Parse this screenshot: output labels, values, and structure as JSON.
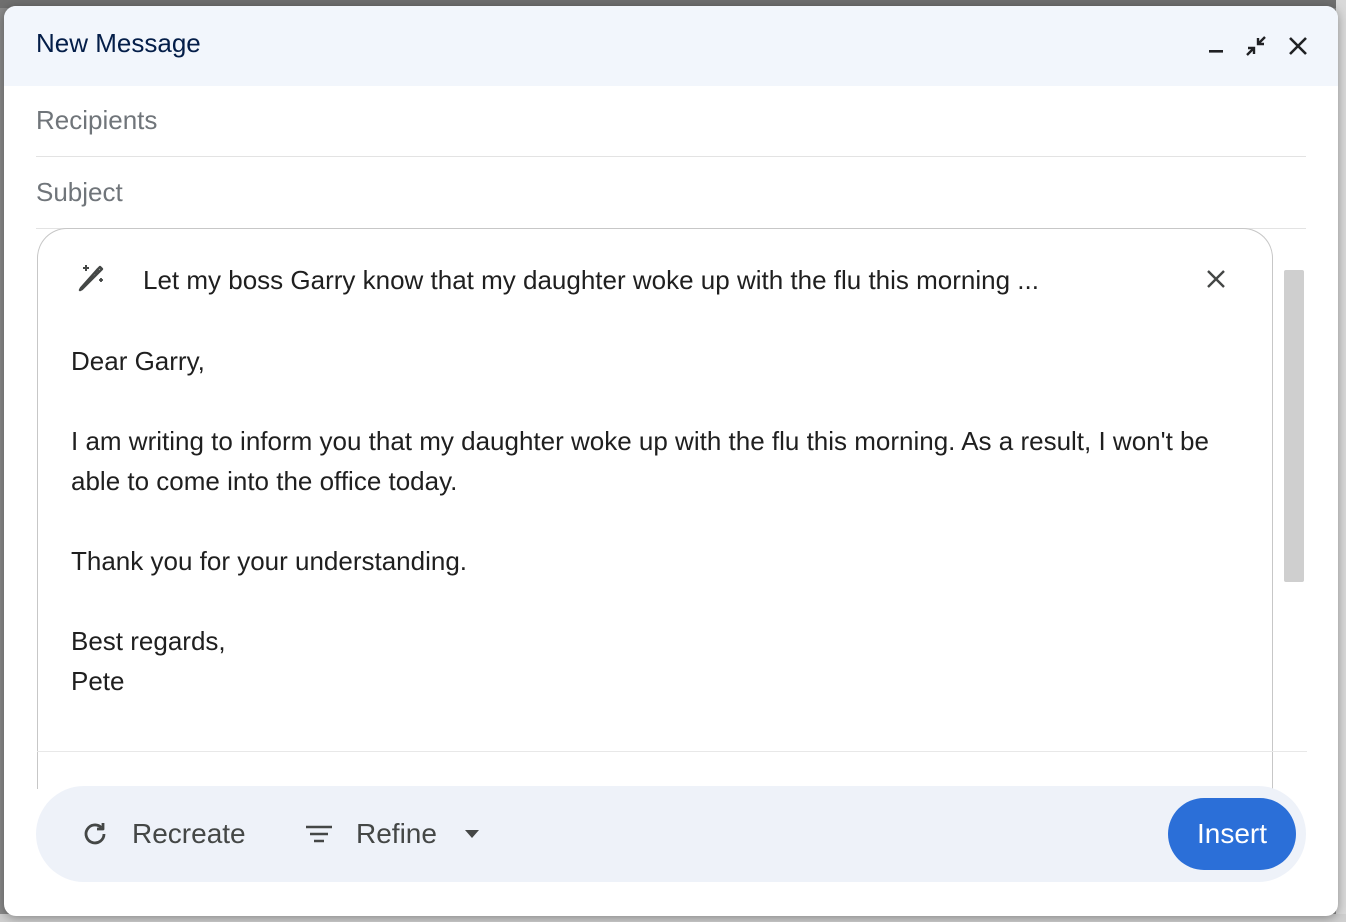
{
  "window": {
    "title": "New Message"
  },
  "titlebar_controls": {
    "minimize_icon": "minimize-icon",
    "collapse_icon": "exit-fullscreen-icon",
    "close_icon": "close-icon"
  },
  "recipients": {
    "placeholder": "Recipients",
    "value": ""
  },
  "subject": {
    "placeholder": "Subject",
    "value": ""
  },
  "ai_prompt": {
    "icon": "magic-pen-icon",
    "text": "Let my boss Garry know that my daughter woke up with the flu this morning ...",
    "close_icon": "close-icon"
  },
  "draft": {
    "greeting": "Dear Garry,",
    "paragraph1": "I am writing to inform you that my daughter woke up with the flu this morning. As a result, I won't be able to come into the office today.",
    "paragraph2": "Thank you for your understanding.",
    "closing": "Best regards,",
    "signature": "Pete"
  },
  "actions": {
    "recreate_label": "Recreate",
    "refine_label": "Refine",
    "insert_label": "Insert"
  },
  "colors": {
    "accent": "#2b6fd8",
    "title": "#041e49",
    "action_bar": "#eef2f9"
  }
}
